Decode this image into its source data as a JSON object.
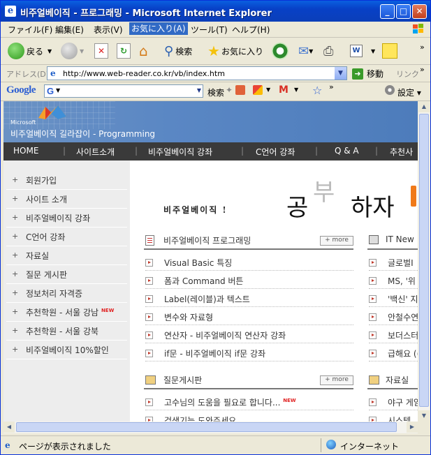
{
  "window": {
    "title": "비주얼베이직 - 프로그래밍 - Microsoft Internet Explorer",
    "controls": {
      "minimize": "_",
      "maximize": "□",
      "close": "✕"
    }
  },
  "menubar": {
    "items": [
      "ファイル(F)",
      "編集(E)",
      "表示(V)",
      "お気に入り(A)",
      "ツール(T)",
      "ヘルプ(H)"
    ],
    "active_index": 3
  },
  "toolbar": {
    "back": "戻る",
    "search": "検索",
    "favorites": "お気に入り"
  },
  "address": {
    "label": "アドレス(D)",
    "url": "http://www.web-reader.co.kr/vb/index.htm",
    "go": "移動",
    "links": "リンク"
  },
  "googlebar": {
    "logo": "Google",
    "search": "検索",
    "settings": "設定"
  },
  "site": {
    "logo_text": "Microsoft",
    "subtitle": "비주얼베이직 길라잡이 - Programming",
    "nav": [
      "HOME",
      "사이트소개",
      "비주얼베이직 강좌",
      "C언어 강좌",
      "Q & A",
      "추천사"
    ],
    "sidebar": [
      {
        "label": "회원가입",
        "new": false
      },
      {
        "label": "사이트 소개",
        "new": false
      },
      {
        "label": "비주얼베이직 강좌",
        "new": false
      },
      {
        "label": "C언어 강좌",
        "new": false
      },
      {
        "label": "자료실",
        "new": false
      },
      {
        "label": "질문 게시판",
        "new": false
      },
      {
        "label": "정보처리 자격증",
        "new": false
      },
      {
        "label": "추천학원 - 서울 강남",
        "new": true
      },
      {
        "label": "추천학원 - 서울 강북",
        "new": false
      },
      {
        "label": "비주얼베이직 10%할인",
        "new": false
      }
    ],
    "new_badge": "NEW",
    "banner": {
      "small": "비주얼베이직 !",
      "big1": "공",
      "big2": "부",
      "big3": "하자"
    },
    "sections": {
      "vb": {
        "title": "비주얼베이직 프로그래밍",
        "more": "+ more",
        "posts": [
          "Visual Basic 특징",
          "폼과 Command 버튼",
          "Label(레이블)과 텍스트",
          "변수와 자료형",
          "연산자 - 비주얼베이직 연산자 강좌",
          "if문 - 비주얼베이직 if문 강좌"
        ]
      },
      "it": {
        "title": "IT New",
        "posts": [
          "글로벌I",
          "MS, '위",
          "'백신' 지",
          "안철수연",
          "보더스터",
          "급해요 (("
        ]
      },
      "qna": {
        "title": "질문게시판",
        "more": "+ more",
        "posts": [
          "고수님의 도움을 필요로 합니다...",
          "검색기능 도와주세요"
        ],
        "new_index": 0
      },
      "data": {
        "title": "자료실",
        "posts": [
          "야구 게임",
          "시스템"
        ]
      }
    }
  },
  "status": {
    "text": "ページが表示されました",
    "zone": "インターネット"
  }
}
